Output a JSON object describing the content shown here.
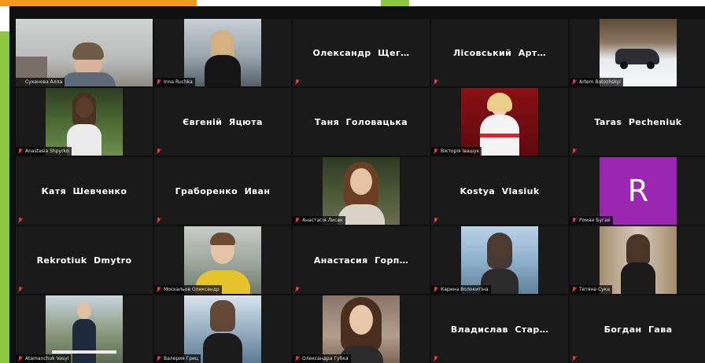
{
  "colors": {
    "accent_orange": "#f39a1e",
    "accent_green": "#8cc63f",
    "active_speaker": "#d2e36b",
    "avatar_bg": "#9b27b0",
    "muted_mic": "#e23b3b"
  },
  "participants": [
    {
      "name": "Суханова Алла",
      "video": true,
      "active": true
    },
    {
      "name": "Inna Ruchka",
      "video": true
    },
    {
      "name": "Олександр  Щег…",
      "video": false
    },
    {
      "name": "Лісовський  Арт…",
      "video": false
    },
    {
      "name": "Artem Batozhskyi",
      "video": true
    },
    {
      "name": "Anastasia Shpyrko",
      "video": true
    },
    {
      "name": "Євгеній  Яцюта",
      "video": false
    },
    {
      "name": "Таня  Головацька",
      "video": false
    },
    {
      "name": "Вікторія Івашук",
      "video": true
    },
    {
      "name": "Taras  Pecheniuk",
      "video": false
    },
    {
      "name": "Катя  Шевченко",
      "video": false
    },
    {
      "name": "Граборенко  Иван",
      "video": false
    },
    {
      "name": "Анастасія Лисак",
      "video": true
    },
    {
      "name": "Kostya  Vlasiuk",
      "video": false
    },
    {
      "name": "Роман Бугай",
      "video": false,
      "avatar_letter": "R"
    },
    {
      "name": "Rekrotiuk  Dmytro",
      "video": false
    },
    {
      "name": "Москальов Олександр",
      "video": true
    },
    {
      "name": "Анастасия  Горп…",
      "video": false
    },
    {
      "name": "Карина Волокитіна",
      "video": true
    },
    {
      "name": "Тетяна Сука",
      "video": true
    },
    {
      "name": "Atamanchuk Vasyl",
      "video": true
    },
    {
      "name": "Валерия Гриц",
      "video": true
    },
    {
      "name": "Олександра Губка",
      "video": true
    },
    {
      "name": "Владислав  Стар…",
      "video": false
    },
    {
      "name": "Богдан  Гава",
      "video": false
    }
  ]
}
